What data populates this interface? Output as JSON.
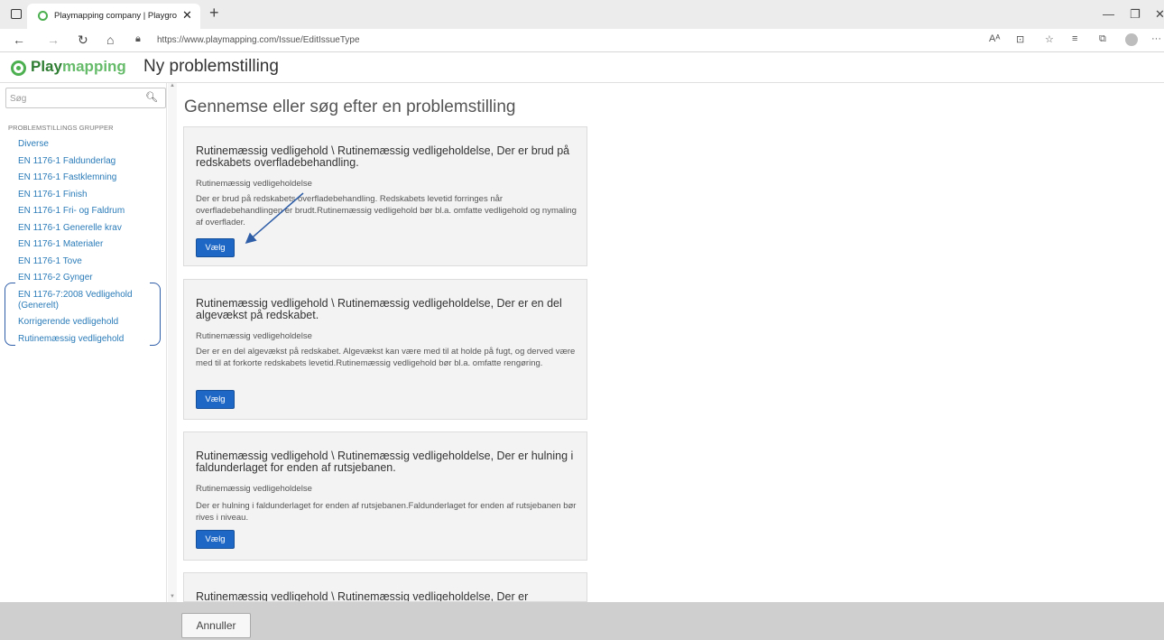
{
  "browser": {
    "tab_title": "Playmapping company | Playgro",
    "url": "https://www.playmapping.com/Issue/EditIssueType"
  },
  "header": {
    "logo_part1": "Play",
    "logo_part2": "mapping",
    "page_title": "Ny problemstilling"
  },
  "sidebar": {
    "search_placeholder": "Søg",
    "group_title": "PROBLEMSTILLINGS GRUPPER",
    "items": [
      "Diverse",
      "EN 1176-1 Faldunderlag",
      "EN 1176-1 Fastklemning",
      "EN 1176-1 Finish",
      "EN 1176-1 Fri- og Faldrum",
      "EN 1176-1 Generelle krav",
      "EN 1176-1 Materialer",
      "EN 1176-1 Tove",
      "EN 1176-2 Gynger",
      "EN 1176-7:2008 Vedligehold (Generelt)",
      "Korrigerende vedligehold",
      "Rutinemæssig vedligehold"
    ]
  },
  "main": {
    "title": "Gennemse eller søg efter en problemstilling",
    "cards": [
      {
        "title": "Rutinemæssig vedligehold \\ Rutinemæssig vedligeholdelse, Der er brud på redskabets overfladebehandling.",
        "subtitle": "Rutinemæssig vedligeholdelse",
        "description": "Der er brud på redskabets overfladebehandling. Redskabets levetid forringes når overfladebehandlingen er brudt.Rutinemæssig vedligehold bør bl.a. omfatte vedligehold og nymaling af overflader.",
        "button": "Vælg"
      },
      {
        "title": "Rutinemæssig vedligehold \\ Rutinemæssig vedligeholdelse, Der er en del algevækst på redskabet.",
        "subtitle": "Rutinemæssig vedligeholdelse",
        "description": "Der er en del algevækst på redskabet. Algevækst kan være med til at holde på fugt, og derved være med til at forkorte redskabets levetid.Rutinemæssig vedligehold bør bl.a. omfatte rengøring.",
        "button": "Vælg"
      },
      {
        "title": "Rutinemæssig vedligehold \\ Rutinemæssig vedligeholdelse, Der er hulning i faldunderlaget for enden af rutsjebanen.",
        "subtitle": "Rutinemæssig vedligeholdelse",
        "description": "Der er hulning i faldunderlaget for enden af rutsjebanen.Faldunderlaget for enden af rutsjebanen bør rives i niveau.",
        "button": "Vælg"
      },
      {
        "title": "Rutinemæssig vedligehold \\ Rutinemæssig vedligeholdelse, Der er",
        "subtitle": "",
        "description": "",
        "button": ""
      }
    ]
  },
  "footer": {
    "cancel_label": "Annuller"
  },
  "colors": {
    "brand_green": "#4caf50",
    "link_blue": "#2a7bb8",
    "button_blue": "#1f67c4",
    "annotation_blue": "#2f5ea8"
  }
}
